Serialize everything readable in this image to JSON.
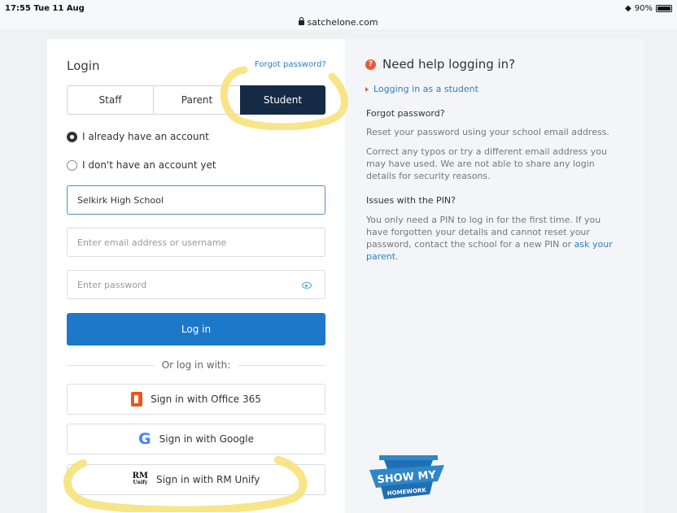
{
  "status_bar": {
    "time": "17:55  Tue 11 Aug",
    "url": "satchelone.com",
    "battery": "90%"
  },
  "login": {
    "title": "Login",
    "forgot_password": "Forgot password?",
    "tabs": [
      {
        "label": "Staff",
        "selected": false
      },
      {
        "label": "Parent",
        "selected": false
      },
      {
        "label": "Student",
        "selected": true
      }
    ],
    "radio_have_account": "I already have an account",
    "radio_no_account": "I don't have an account yet",
    "school_value": "Selkirk High School",
    "email_placeholder": "Enter email address or username",
    "password_placeholder": "Enter password",
    "login_button": "Log in",
    "or_text": "Or log in with:",
    "sso_office": "Sign in with Office 365",
    "sso_google": "Sign in with Google",
    "sso_rm": "Sign in with RM Unify"
  },
  "help": {
    "title": "Need help logging in?",
    "student_link": "Logging in as a student",
    "forgot_heading": "Forgot password?",
    "forgot_p1": "Reset your password using your school email address.",
    "forgot_p2": "Correct any typos or try a different email address you may have used. We are not able to share any login details for security reasons.",
    "pin_heading": "Issues with the PIN?",
    "pin_text": "You only need a PIN to log in for the first time. If you have forgotten your details and cannot reset your password, contact the school for a new PIN or ",
    "pin_link": "ask your parent",
    "pin_end": "."
  },
  "logo": {
    "line1": "SHOW MY",
    "line2": "HOMEWORK"
  },
  "colors": {
    "primary": "#1e78c9",
    "selected_tab": "#152a45",
    "link": "#2a7fc1",
    "highlight": "#f6e27a"
  }
}
